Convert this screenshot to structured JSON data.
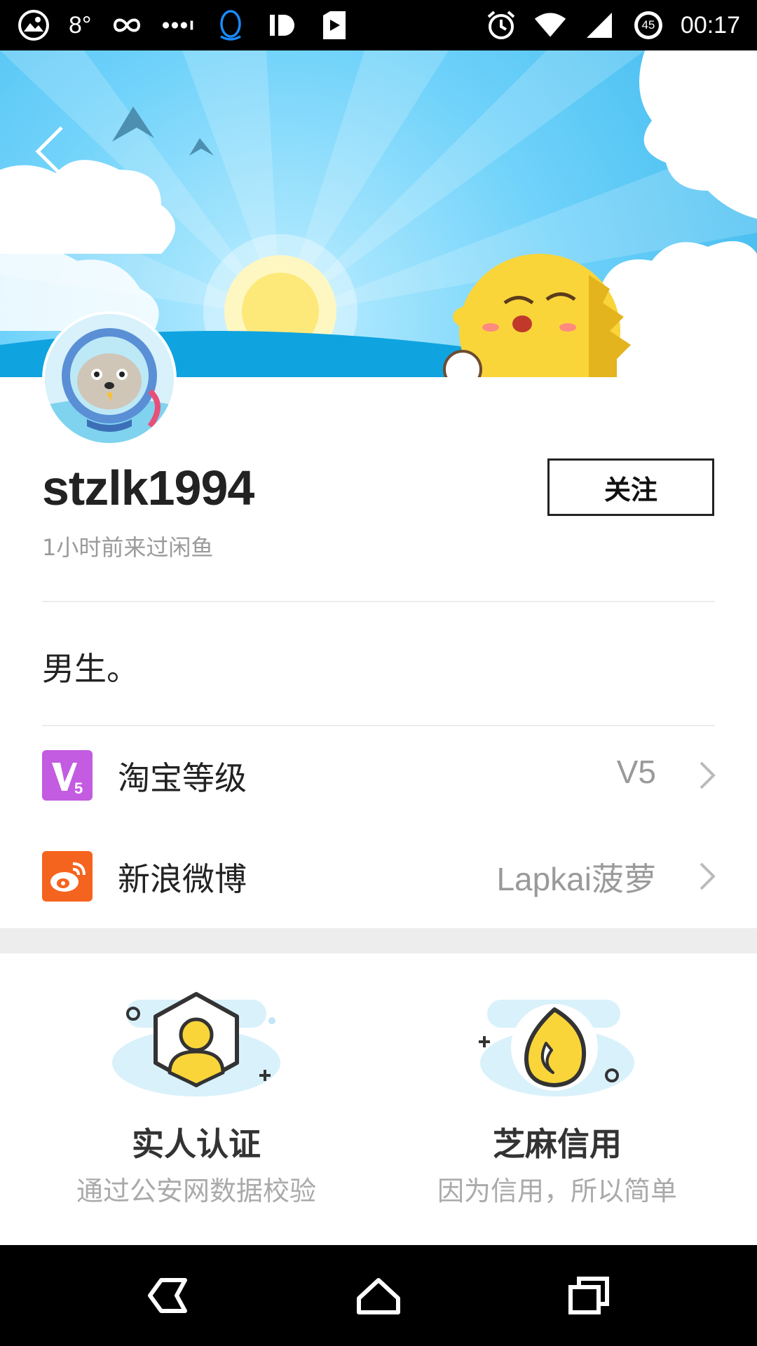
{
  "status_bar": {
    "temperature": "8°",
    "battery": "45",
    "time": "00:17"
  },
  "profile": {
    "username": "stzlk1994",
    "last_seen": "1小时前来过闲鱼",
    "follow_label": "关注",
    "bio": "男生。"
  },
  "rows": [
    {
      "label": "淘宝等级",
      "value": "V5",
      "icon": "v5-level-icon",
      "color": "#c35ce0"
    },
    {
      "label": "新浪微博",
      "value": "Lapkai菠萝",
      "icon": "weibo-icon",
      "color": "#f5641e"
    }
  ],
  "cards": [
    {
      "title": "实人认证",
      "subtitle": "通过公安网数据校验",
      "icon": "real-person-verify-icon"
    },
    {
      "title": "芝麻信用",
      "subtitle": "因为信用，所以简单",
      "icon": "sesame-credit-icon"
    }
  ],
  "colors": {
    "banner_sky": "#4cc3f3",
    "accent_yellow": "#f9d53a",
    "text_primary": "#222222",
    "text_secondary": "#9a9a9a"
  }
}
